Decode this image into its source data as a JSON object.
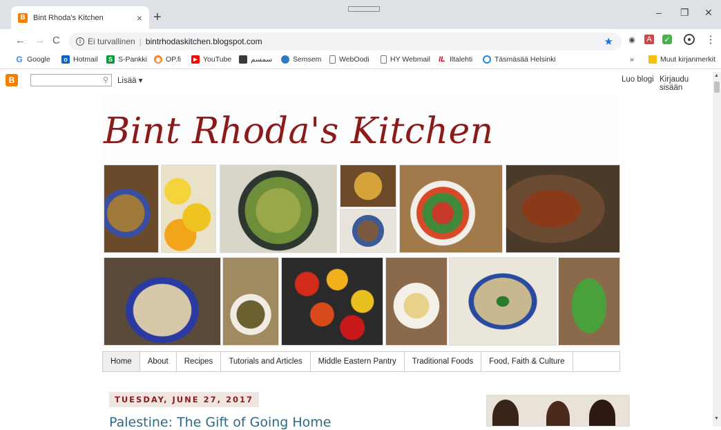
{
  "browser": {
    "tab_title": "Bint Rhoda's Kitchen",
    "tab_close": "×",
    "new_tab": "+",
    "minimize": "–",
    "restore": "❐",
    "close": "✕",
    "back": "←",
    "forward": "→",
    "reload": "C",
    "security_label": "Ei turvallinen",
    "url": "bintrhodaskitchen.blogspot.com",
    "menu": "⋮"
  },
  "bookmarks": [
    {
      "label": "Google",
      "icon": "G",
      "color": "#4285f4"
    },
    {
      "label": "Hotmail",
      "icon": "o",
      "color": "#0a64c7"
    },
    {
      "label": "S-Pankki",
      "icon": "S",
      "color": "#0a9a3c"
    },
    {
      "label": "OP.fi",
      "icon": "◉",
      "color": "#f58220"
    },
    {
      "label": "YouTube",
      "icon": "▶",
      "color": "#ff0000"
    },
    {
      "label": "سمسم",
      "icon": "▬",
      "color": "#3a3a3a"
    },
    {
      "label": "Semsem",
      "icon": "●",
      "color": "#2f7bbf"
    },
    {
      "label": "WebOodi",
      "icon": "▯",
      "color": "#777"
    },
    {
      "label": "HY Webmail",
      "icon": "▯",
      "color": "#777"
    },
    {
      "label": "Iltalehti",
      "icon": "IL",
      "color": "#d6001c"
    },
    {
      "label": "Täsmäsää Helsinki",
      "icon": "○",
      "color": "#1e88e5"
    }
  ],
  "bookmarks_overflow": "»",
  "other_bookmarks": "Muut kirjanmerkit",
  "blogger_nav": {
    "more": "Lisää ▾",
    "create_blog": "Luo blogi",
    "sign_in": "Kirjaudu sisään"
  },
  "blog": {
    "title": "Bint Rhoda's Kitchen",
    "nav_tabs": [
      "Home",
      "About",
      "Recipes",
      "Tutorials and Articles",
      "Middle Eastern Pantry",
      "Traditional Foods",
      "Food, Faith & Culture"
    ],
    "date": "TUESDAY, JUNE 27, 2017",
    "post_title": "Palestine: The Gift of Going Home"
  },
  "colors": {
    "title": "#8b1a1a",
    "link": "#2b6a87",
    "date_bg": "#f0e6e1",
    "blogger": "#f57d00"
  }
}
